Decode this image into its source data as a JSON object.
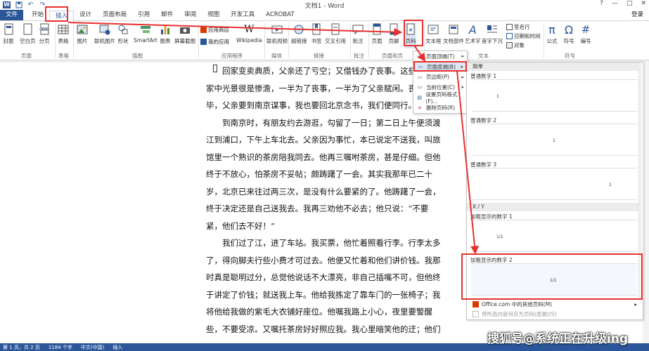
{
  "window": {
    "title": "文档1 - Word",
    "controls": [
      "?",
      "—",
      "□",
      "✕"
    ],
    "login": "登录"
  },
  "qat": {
    "logo": "W",
    "save_icon": "save-icon",
    "undo_icon": "undo-icon",
    "redo_icon": "redo-icon"
  },
  "tabs": [
    {
      "label": "文件"
    },
    {
      "label": "开始"
    },
    {
      "label": "插入"
    },
    {
      "label": "设计"
    },
    {
      "label": "页面布局"
    },
    {
      "label": "引用"
    },
    {
      "label": "邮件"
    },
    {
      "label": "审阅"
    },
    {
      "label": "视图"
    },
    {
      "label": "开发工具"
    },
    {
      "label": "ACROBAT"
    }
  ],
  "ribbon": {
    "buttons": {
      "cover": "封面",
      "blank": "空白页",
      "pagebreak": "分页",
      "table": "表格",
      "picture": "图片",
      "online_pic": "联机图片",
      "shapes": "形状",
      "smartart": "SmartArt",
      "chart": "图表",
      "screenshot": "屏幕截图",
      "app_store": "应用商店",
      "my_apps": "我的应用",
      "wikipedia": "Wikipedia",
      "online_video": "联机视频",
      "hyperlink": "超链接",
      "bookmark": "书签",
      "crossref": "交叉引用",
      "comment": "批注",
      "header": "页眉",
      "footer": "页脚",
      "pagenum": "页码",
      "textbox": "文本框",
      "docparts": "文档部件",
      "wordart": "艺术字",
      "dropcap": "首字下沉",
      "signature": "签名行",
      "datetime": "日期和时间",
      "object": "对象",
      "equation": "公式",
      "symbol": "符号",
      "number": "编号"
    },
    "groups": {
      "pages": "页面",
      "tables": "表格",
      "illustrations": "插图",
      "apps": "应用程序",
      "media": "媒体",
      "links": "链接",
      "comments": "批注",
      "headerfooter": "页眉和页",
      "text": "文本",
      "symbols": "符号"
    },
    "symbol_glyphs": {
      "equation": "π",
      "symbol": "Ω",
      "number": "#",
      "wikipedia": "W",
      "wordart": "A"
    }
  },
  "document": {
    "paragraphs": [
      "回家变卖典质，父亲还了亏空；又借钱办了丧事。这些日子，",
      "家中光景很是惨澹，一半为了丧事，一半为了父亲赋闲。丧事完",
      "毕，父亲要到南京谋事，我也要回北京念书，我们便同行。",
      "到南京时，有朋友约去游逛，勾留了一日；第二日上午便须渡",
      "江到浦口，下午上车北去。父亲因为事忙，本已说定不送我，叫旅",
      "馆里一个熟识的茶房陪我同去。他再三嘱咐茶房，甚是仔细。但他",
      "终于不放心，怕茶房不妥帖；颇踌躇了一会。其实我那年已二十",
      "岁，北京已来往过两三次，是没有什么要紧的了。他踌躇了一会，",
      "终于决定还是自己送我去。我再三劝他不必去；他只说：“不要",
      "紧，他们去不好！”",
      "我们过了江，进了车站。我买票，他忙着照看行李。行李太多",
      "了，得向脚夫行些小费才可过去。他便又忙着和他们讲价钱。我那",
      "时真是聪明过分，总觉他说话不大漂亮，非自己插嘴不可，但他终",
      "于讲定了价钱；就送我上车。他给我拣定了靠车门的一张椅子；我",
      "将他给我做的紫毛大衣铺好座位。他嘱我路上小心，夜里要警醒",
      "些，不要受凉。又嘱托茶房好好照应我。我心里暗笑他的迂；他们"
    ],
    "indented": [
      3,
      10
    ]
  },
  "pagenum_menu": {
    "items": [
      {
        "label": "页面顶端(T)",
        "icon": "page-top-icon",
        "arrow": "▸"
      },
      {
        "label": "页面底端(B)",
        "icon": "page-bottom-icon",
        "arrow": "▸"
      },
      {
        "label": "页边距(P)",
        "icon": "page-margin-icon",
        "arrow": "▸"
      },
      {
        "label": "当前位置(C)",
        "icon": "current-pos-icon",
        "arrow": "▸"
      },
      {
        "label": "设置页码格式(F)...",
        "icon": "format-icon",
        "arrow": ""
      },
      {
        "label": "删除页码(R)",
        "icon": "delete-icon",
        "arrow": ""
      }
    ]
  },
  "gallery": {
    "section_simple": "简单",
    "section_xofy": "X / Y",
    "items": [
      {
        "label": "普通数字 1",
        "num": "1"
      },
      {
        "label": "普通数字 2",
        "num": "1"
      },
      {
        "label": "普通数字 3",
        "num": "1"
      },
      {
        "label": "加粗显示的数字 1",
        "num": "1/1"
      },
      {
        "label": "加粗显示的数字 2",
        "num": "1/1"
      }
    ],
    "footer_items": [
      {
        "label": "Office.com 中的其他页码(M)",
        "arrow": "▸"
      },
      {
        "label": "将所选内容另存为页码(底端)(S)",
        "arrow": ""
      }
    ]
  },
  "status": {
    "page": "第 1 页，共 2 页",
    "words": "1184 个字",
    "lang": "中文(中国)",
    "mode": "插入"
  },
  "watermark": "搜狐号@系统正在升级ing",
  "colors": {
    "accent": "#2b579a",
    "highlight": "#e83030"
  }
}
